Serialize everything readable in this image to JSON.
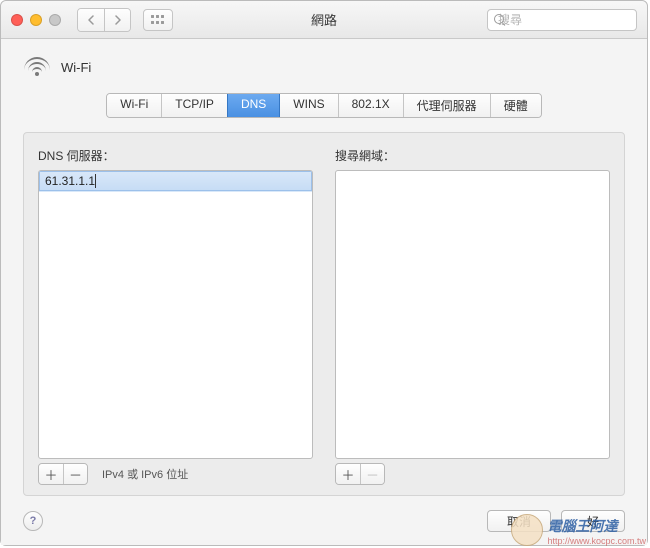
{
  "window": {
    "title": "網路"
  },
  "search": {
    "placeholder": "搜尋"
  },
  "connection": {
    "name": "Wi-Fi"
  },
  "tabs": [
    {
      "label": "Wi-Fi"
    },
    {
      "label": "TCP/IP"
    },
    {
      "label": "DNS"
    },
    {
      "label": "WINS"
    },
    {
      "label": "802.1X"
    },
    {
      "label": "代理伺服器"
    },
    {
      "label": "硬體"
    }
  ],
  "active_tab_index": 2,
  "dns": {
    "label": "DNS 伺服器：",
    "servers": [
      "61.31.1.1"
    ],
    "hint": "IPv4 或 IPv6 位址"
  },
  "search_domains": {
    "label": "搜尋網域：",
    "domains": []
  },
  "buttons": {
    "cancel": "取消",
    "ok": "好"
  },
  "watermark": {
    "brand": "電腦王阿達",
    "url": "http://www.kocpc.com.tw"
  }
}
